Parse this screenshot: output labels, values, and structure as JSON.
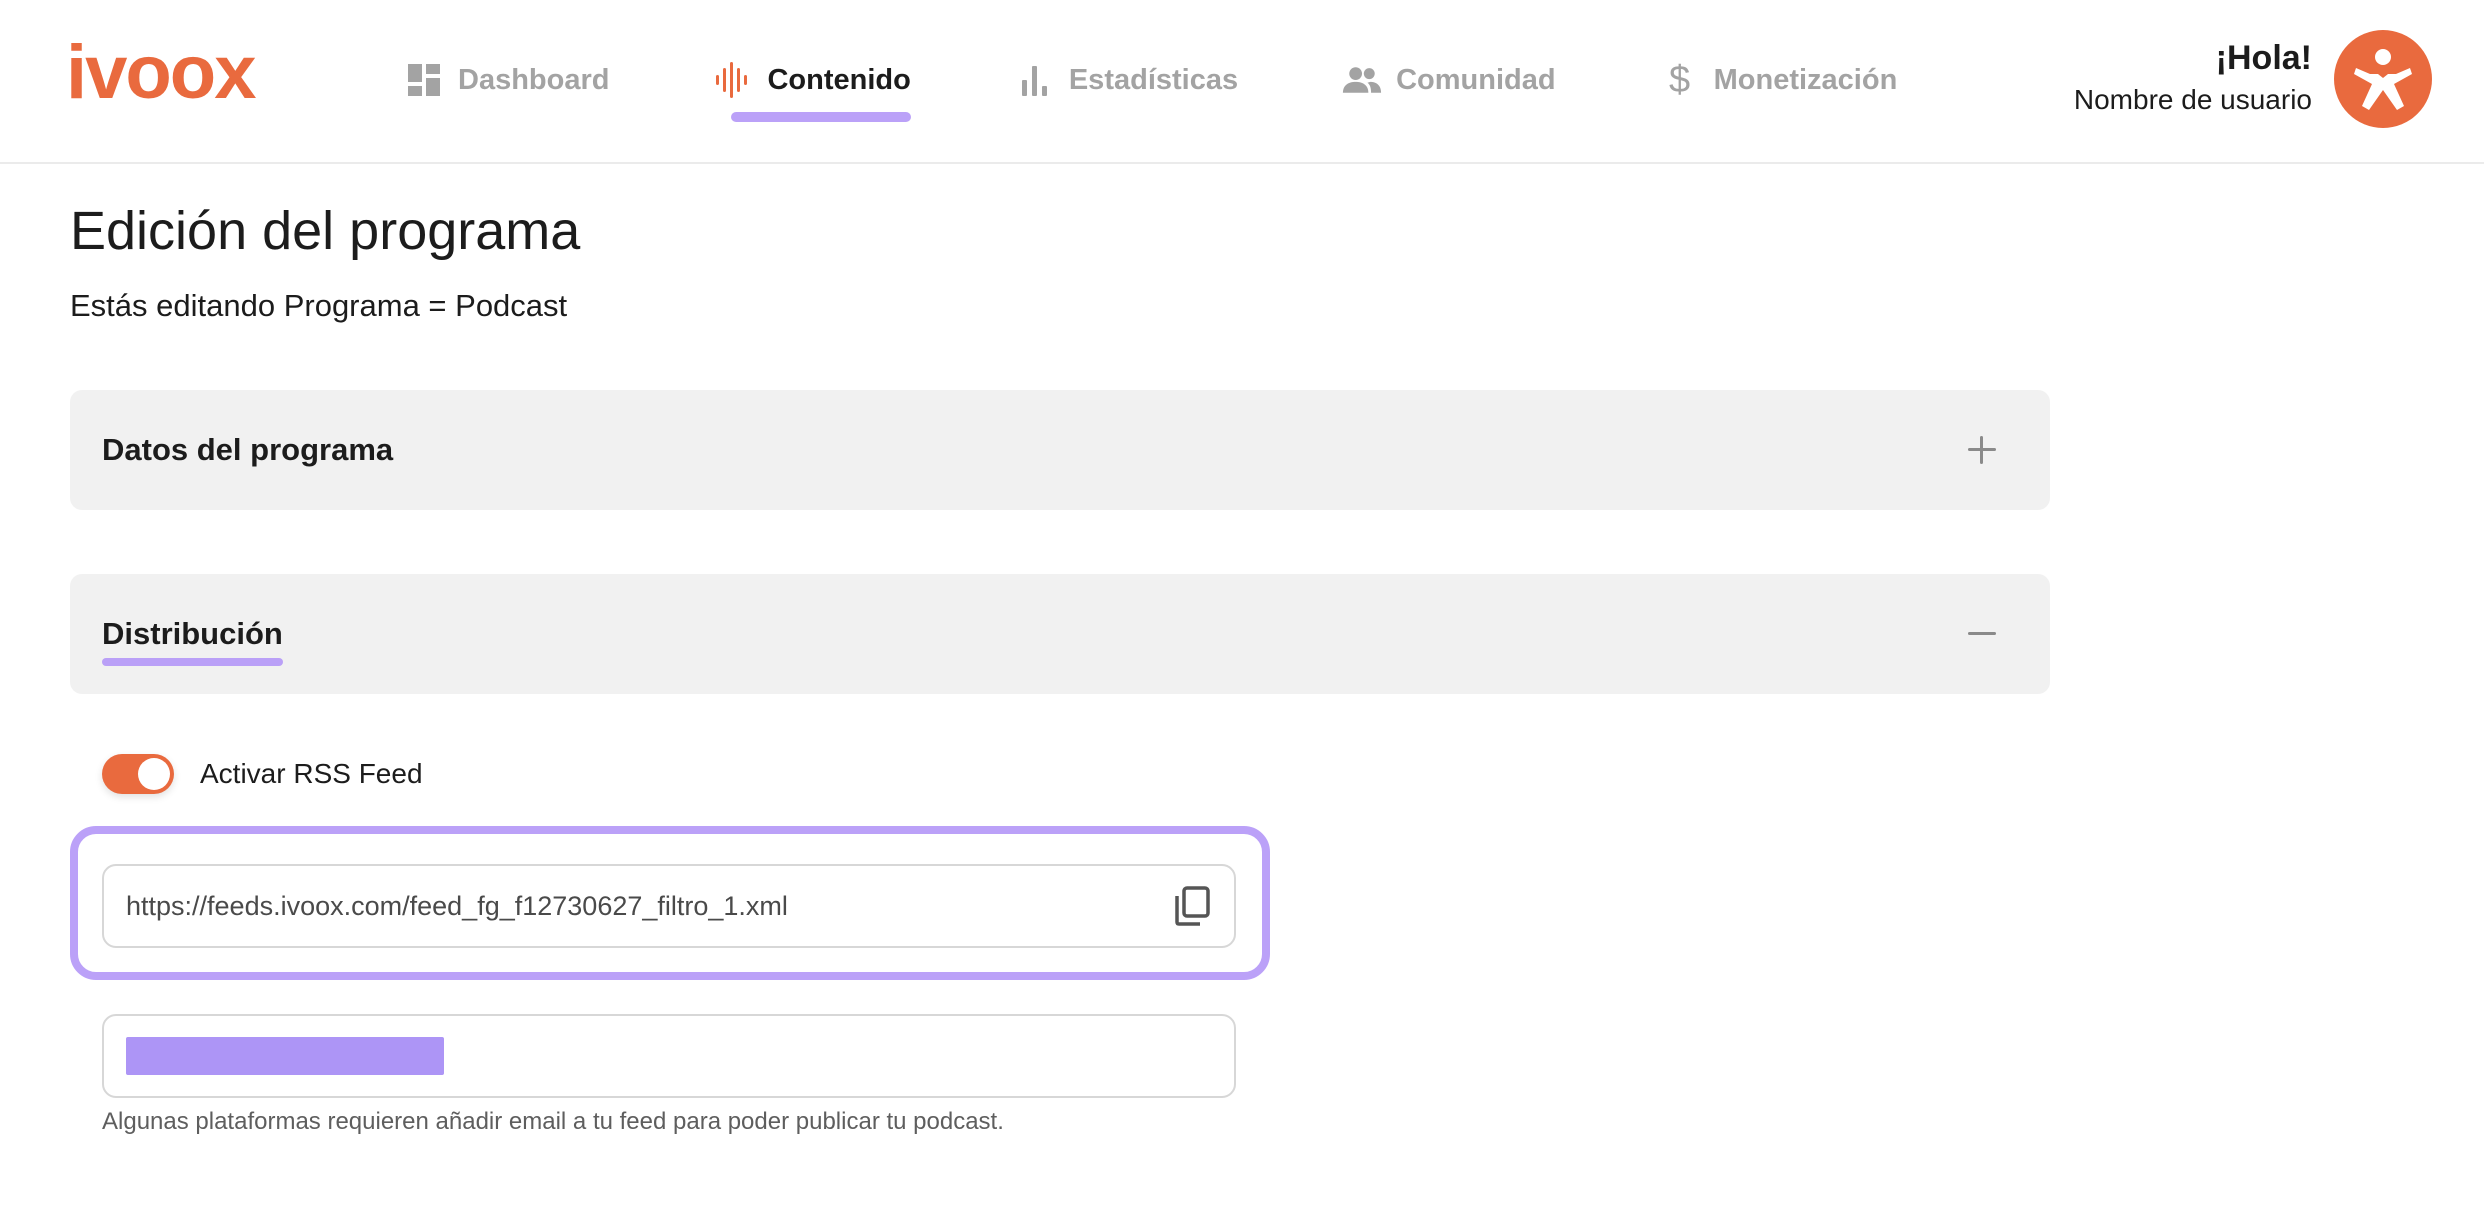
{
  "brand": {
    "logo_text": "ivoox",
    "accent_color": "#e96a3e",
    "highlight_color": "#b497f7"
  },
  "nav": {
    "items": [
      {
        "label": "Dashboard",
        "icon": "dashboard-icon",
        "active": false
      },
      {
        "label": "Contenido",
        "icon": "audio-wave-icon",
        "active": true
      },
      {
        "label": "Estadísticas",
        "icon": "bar-chart-icon",
        "active": false
      },
      {
        "label": "Comunidad",
        "icon": "people-icon",
        "active": false
      },
      {
        "label": "Monetización",
        "icon": "dollar-icon",
        "active": false
      }
    ]
  },
  "user": {
    "greeting": "¡Hola!",
    "username": "Nombre de usuario",
    "avatar_icon": "ivoox-avatar-icon"
  },
  "page": {
    "title": "Edición del programa",
    "subtitle": "Estás editando Programa = Podcast"
  },
  "sections": [
    {
      "title": "Datos del programa",
      "expanded": false,
      "toggle_icon": "plus-icon"
    },
    {
      "title": "Distribución",
      "expanded": true,
      "toggle_icon": "minus-icon"
    }
  ],
  "distribution": {
    "rss_toggle_label": "Activar RSS Feed",
    "rss_enabled": true,
    "feed_url": "https://feeds.ivoox.com/feed_fg_f12730627_filtro_1.xml",
    "copy_icon": "copy-icon",
    "email_hint": "Algunas plataformas requieren añadir email a tu feed para poder publicar tu podcast."
  }
}
